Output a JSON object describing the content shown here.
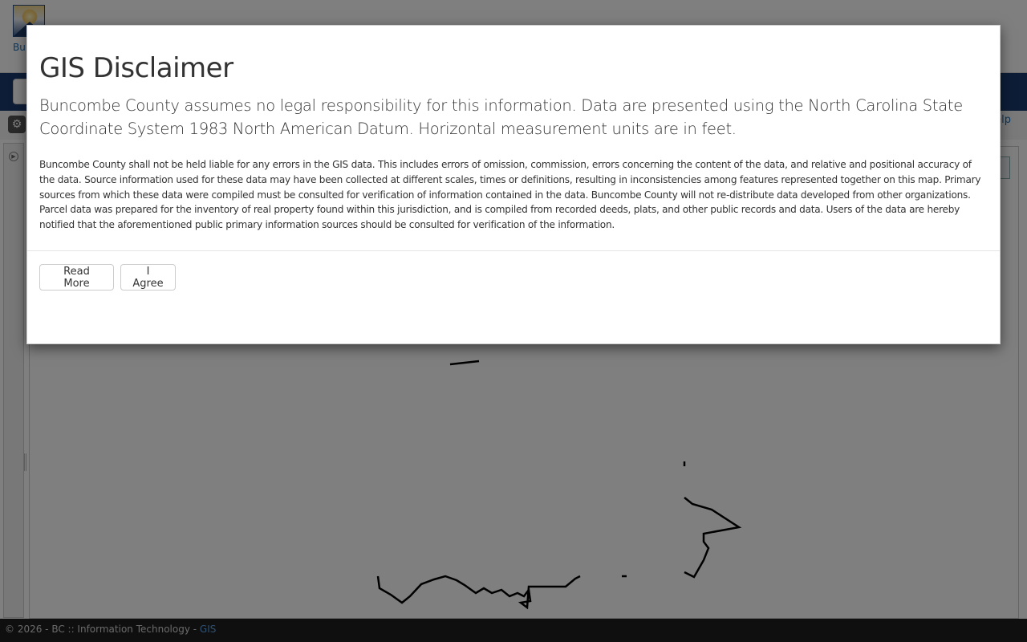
{
  "app": {
    "logo_label": "Buncombe County",
    "help_label": "Help"
  },
  "footer": {
    "copyright": "© 2026 - BC :: Information Technology - ",
    "gis_link": "GIS"
  },
  "modal": {
    "title": "GIS Disclaimer",
    "lead": "Buncombe County assumes no legal responsibility for this information. Data are presented using the North Carolina State Coordinate System 1983 North American Datum. Horizontal measurement units are in feet.",
    "body": "Buncombe County shall not be held liable for any errors in the GIS data. This includes errors of omission, commission, errors concerning the content of the data, and relative and positional accuracy of the data. Source information used for these data may have been collected at different scales, times or definitions, resulting in inconsistencies among features represented together on this map. Primary sources from which these data were compiled must be consulted for verification of information contained in the data. Buncombe County will not re-distribute data developed from other organizations. Parcel data was prepared for the inventory of real property found within this jurisdiction, and is compiled from recorded deeds, plats, and other public records and data. Users of the data are hereby notified that the aforementioned public primary information sources should be consulted for verification of the information.",
    "read_more_label": "Read More",
    "agree_label": "I Agree"
  },
  "icons": {
    "tool": "settings-icon",
    "sidebar_toggle": "expand-icon"
  }
}
